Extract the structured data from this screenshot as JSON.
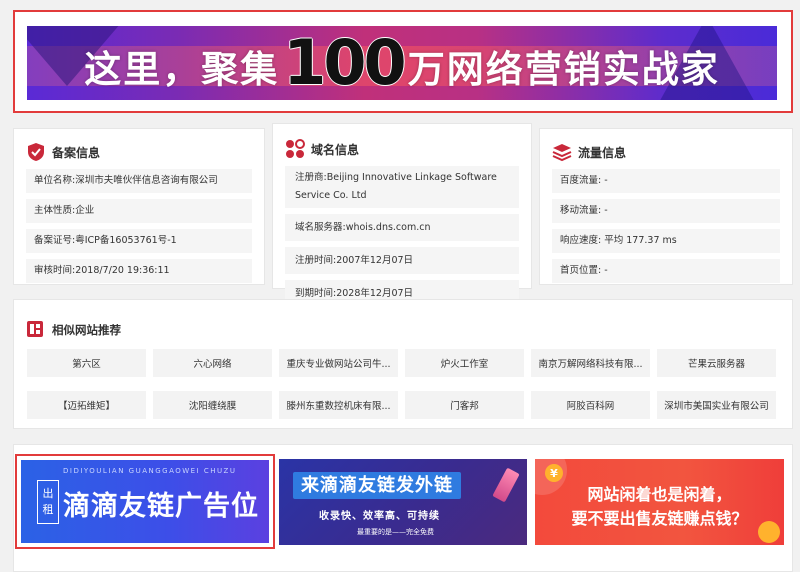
{
  "top_banner": {
    "text_left": "这里，聚集",
    "number": "100",
    "text_right": "万网络营销实战家"
  },
  "record_card": {
    "title": "备案信息",
    "rows": [
      {
        "label": "单位名称:",
        "value": "深圳市夫唯伙伴信息咨询有限公司"
      },
      {
        "label": "主体性质:",
        "value": "企业"
      },
      {
        "label": "备案证号:",
        "value": "粤ICP备16053761号-1"
      },
      {
        "label": "审核时间:",
        "value": "2018/7/20 19:36:11"
      }
    ]
  },
  "domain_card": {
    "title": "域名信息",
    "rows": [
      {
        "label": "注册商:",
        "value": "Beijing Innovative Linkage Software Service Co. Ltd"
      },
      {
        "label": "域名服务器:",
        "value": "whois.dns.com.cn"
      },
      {
        "label": "注册时间:",
        "value": "2007年12月07日"
      },
      {
        "label": "到期时间:",
        "value": "2028年12月07日"
      }
    ]
  },
  "traffic_card": {
    "title": "流量信息",
    "rows": [
      {
        "label": "百度流量:",
        "value": "-"
      },
      {
        "label": "移动流量:",
        "value": "-"
      },
      {
        "label": "响应速度:",
        "value": "平均 177.37 ms"
      },
      {
        "label": "首页位置:",
        "value": "-"
      }
    ]
  },
  "similar_sites": {
    "title": "相似网站推荐",
    "items": [
      "第六区",
      "六心网络",
      "重庆专业做网站公司牛...",
      "炉火工作室",
      "南京万解网络科技有限...",
      "芒果云服务器",
      "【迈拓维矩】",
      "沈阳缠绕膜",
      "滕州东重数控机床有限...",
      "门客邦",
      "阿胶百科网",
      "深圳市美国实业有限公司"
    ]
  },
  "ads": {
    "ad1": {
      "sub": "DIDIYOULIAN GUANGGAOWEI CHUZU",
      "tag_top": "出",
      "tag_bottom": "租",
      "main": "滴滴友链广告位"
    },
    "ad2": {
      "line1": "来滴滴友链发外链",
      "line2": "收录快、效率高、可持续",
      "line3": "最重要的是——完全免费"
    },
    "ad3": {
      "coin": "¥",
      "line1": "网站闲着也是闲着，",
      "line2": "要不要出售友链赚点钱？"
    }
  },
  "colors": {
    "accent_red": "#e23b3b",
    "icon_red": "#c9283a"
  }
}
